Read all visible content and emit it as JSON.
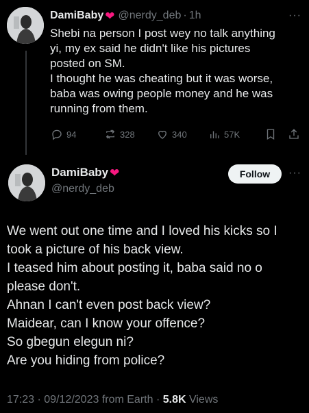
{
  "reply": {
    "author_name": "DamiBaby",
    "author_handle": "@nerdy_deb",
    "separator": "·",
    "time_ago": "1h",
    "more_label": "···",
    "text_lines": [
      "Shebi na person I post wey no talk anything",
      "yi, my ex said he didn't like his pictures",
      "posted on SM.",
      "I thought he was cheating but it was worse,",
      "baba was owing people money and he was",
      "running from them."
    ],
    "stats": {
      "replies": "94",
      "reposts": "328",
      "likes": "340",
      "views": "57K"
    }
  },
  "main": {
    "author_name": "DamiBaby",
    "author_handle": "@nerdy_deb",
    "follow_label": "Follow",
    "more_label": "···",
    "text_lines": [
      "We went out one time and I loved his kicks so I",
      "took a picture of his back view.",
      "I teased him about posting it, baba said no o",
      "please don't.",
      "Ahnan I can't even post back view?",
      "Maidear, can I know your offence?",
      "So gbegun elegun ni?",
      "Are you hiding from police?"
    ],
    "time": "17:23",
    "dot": "·",
    "date": "09/12/2023",
    "source": "from Earth",
    "views_count": "5.8K",
    "views_label": "Views"
  },
  "colors": {
    "background": "#000000",
    "text": "#e7e9ea",
    "muted": "#71767b",
    "heart": "#f91880",
    "follow_bg": "#eff3f4"
  },
  "icons": {
    "heart": "red-heart-emoji",
    "reply": "comment-icon",
    "repost": "repost-icon",
    "like": "like-icon",
    "views": "views-icon",
    "bookmark": "bookmark-icon",
    "share": "share-icon"
  }
}
